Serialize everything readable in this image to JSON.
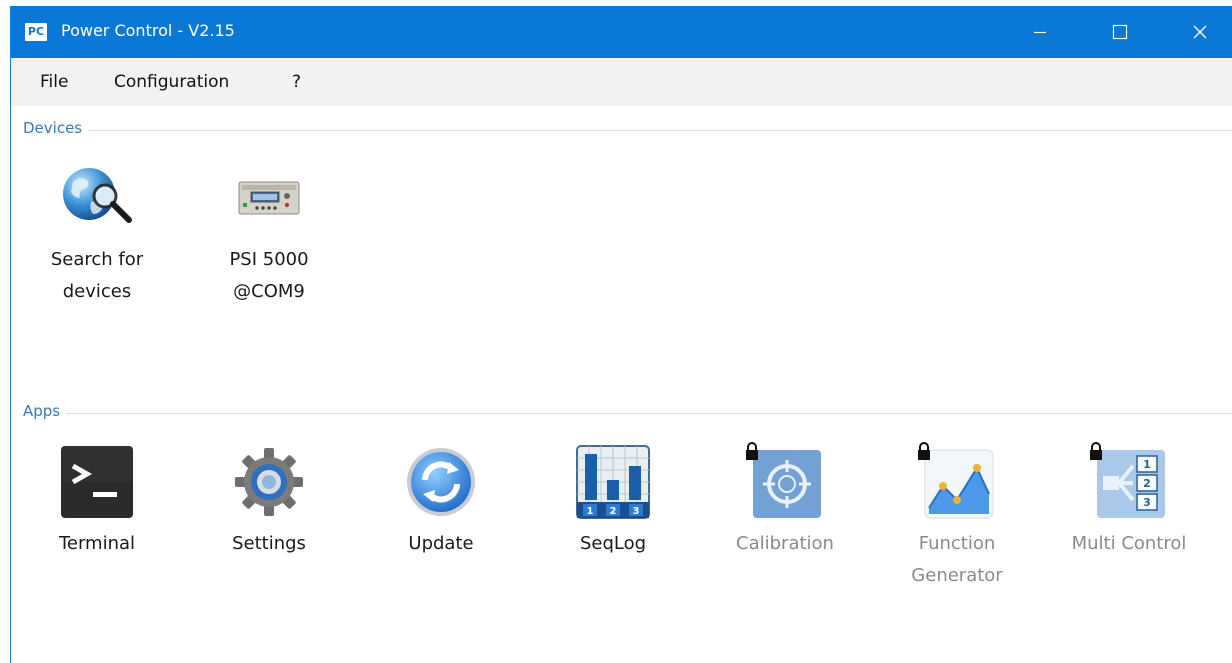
{
  "window": {
    "badge": "PC",
    "title": "Power Control - V2.15"
  },
  "menu": {
    "file": "File",
    "configuration": "Configuration",
    "help": "?"
  },
  "devices": {
    "section_label": "Devices",
    "items": [
      {
        "line1": "Search for",
        "line2": "devices",
        "icon": "globe-search-icon"
      },
      {
        "line1": "PSI 5000",
        "line2": "@COM9",
        "icon": "power-supply-icon"
      }
    ]
  },
  "apps": {
    "section_label": "Apps",
    "items": [
      {
        "line1": "Terminal",
        "line2": "",
        "icon": "terminal-icon",
        "locked": false
      },
      {
        "line1": "Settings",
        "line2": "",
        "icon": "gear-icon",
        "locked": false
      },
      {
        "line1": "Update",
        "line2": "",
        "icon": "update-icon",
        "locked": false
      },
      {
        "line1": "SeqLog",
        "line2": "",
        "icon": "seqlog-icon",
        "locked": false
      },
      {
        "line1": "Calibration",
        "line2": "",
        "icon": "calibration-icon",
        "locked": true
      },
      {
        "line1": "Function",
        "line2": "Generator",
        "icon": "function-generator-icon",
        "locked": true
      },
      {
        "line1": "Multi Control",
        "line2": "",
        "icon": "multi-control-icon",
        "locked": true
      }
    ]
  },
  "colors": {
    "titlebar": "#0a78d7",
    "menubar": "#f2f2f2",
    "section_label": "#3a78b5",
    "disabled_text": "#8a8a8a"
  }
}
